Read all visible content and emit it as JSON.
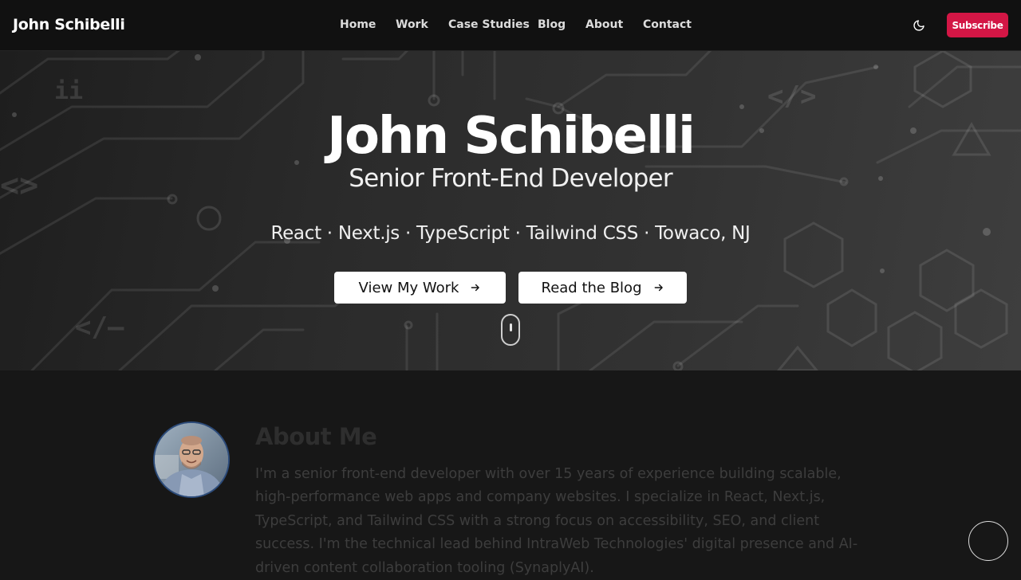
{
  "header": {
    "brand": "John Schibelli",
    "nav": [
      "Home",
      "Work",
      "Case Studies",
      "Blog",
      "About",
      "Contact"
    ],
    "theme_icon": "moon-icon",
    "subscribe_label": "Subscribe"
  },
  "hero": {
    "title": "John Schibelli",
    "subtitle": "Senior Front-End Developer",
    "tech_line": "React · Next.js · TypeScript · Tailwind CSS · Towaco, NJ",
    "primary_button": "View My Work",
    "secondary_button": "Read the Blog",
    "button_icon": "arrow-right-icon",
    "scroll_icon": "mouse-scroll-icon"
  },
  "about": {
    "heading": "About Me",
    "paragraph": "I'm a senior front-end developer with over 15 years of experience building scalable, high-performance web apps and company websites. I specialize in React, Next.js, TypeScript, and Tailwind CSS with a strong focus on accessibility, SEO, and client success. I'm the technical lead behind IntraWeb Technologies' digital presence and AI-driven content collaboration tooling (SynaplyAI)."
  },
  "colors": {
    "accent": "#d31645",
    "header_bg": "#111111",
    "page_bg": "#171717"
  }
}
